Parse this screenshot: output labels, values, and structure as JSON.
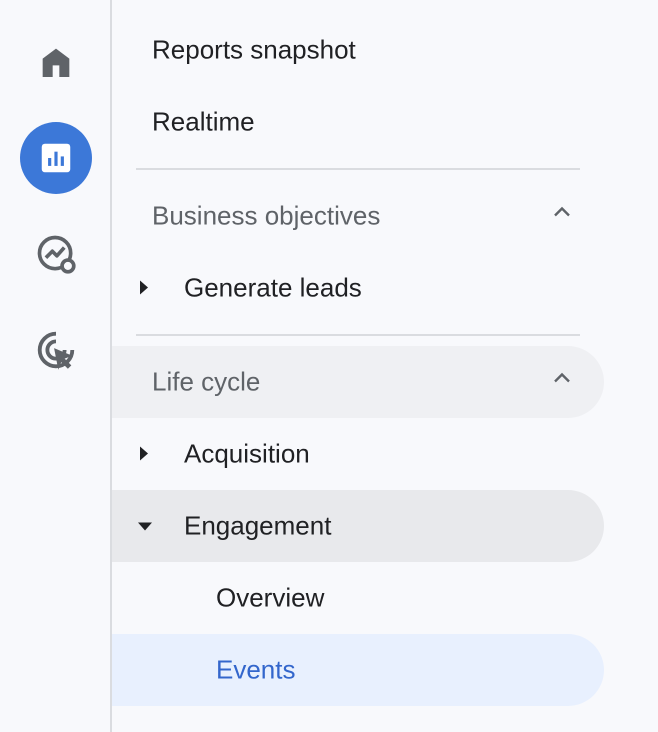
{
  "rail": {
    "items": [
      {
        "name": "home-icon",
        "active": false
      },
      {
        "name": "reports-icon",
        "active": true
      },
      {
        "name": "explore-icon",
        "active": false
      },
      {
        "name": "advertising-icon",
        "active": false
      }
    ]
  },
  "nav": {
    "reports_snapshot": "Reports snapshot",
    "realtime": "Realtime",
    "business_objectives": "Business objectives",
    "generate_leads": "Generate leads",
    "life_cycle": "Life cycle",
    "acquisition": "Acquisition",
    "engagement": "Engagement",
    "overview": "Overview",
    "events": "Events"
  },
  "colors": {
    "accent": "#3c78d8",
    "selected_bg": "#e8f0fe",
    "selected_text": "#3366cc"
  }
}
